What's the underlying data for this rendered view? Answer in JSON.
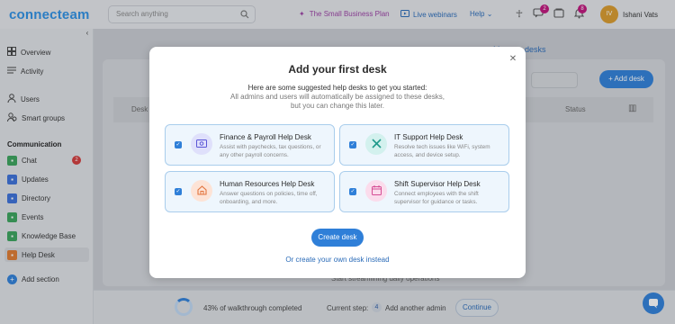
{
  "topbar": {
    "logo": "connecteam",
    "search_placeholder": "Search anything",
    "plan_label": "The Small Business Plan",
    "webinars_label": "Live webinars",
    "help_label": "Help",
    "chat_badge": "2",
    "notif_badge": "8",
    "user_initials": "IV",
    "user_name": "Ishani Vats"
  },
  "sidebar": {
    "items_top": [
      {
        "label": "Overview",
        "icon": "grid-icon"
      },
      {
        "label": "Activity",
        "icon": "list-icon"
      }
    ],
    "items_people": [
      {
        "label": "Users",
        "icon": "user-icon"
      },
      {
        "label": "Smart groups",
        "icon": "users-icon"
      }
    ],
    "section_title": "Communication",
    "items_comm": [
      {
        "label": "Chat",
        "icon": "chat-icon",
        "color": "#3aa35b",
        "badge": "2"
      },
      {
        "label": "Updates",
        "icon": "megaphone-icon",
        "color": "#3b6fd8"
      },
      {
        "label": "Directory",
        "icon": "book-icon",
        "color": "#3b6fd8"
      },
      {
        "label": "Events",
        "icon": "calendar-icon",
        "color": "#3aa35b"
      },
      {
        "label": "Knowledge Base",
        "icon": "folder-icon",
        "color": "#3aa35b"
      },
      {
        "label": "Help Desk",
        "icon": "helpdesk-icon",
        "color": "#e07a2f"
      }
    ],
    "add_section": "Add section"
  },
  "background": {
    "manage_desks": "Manage desks",
    "add_desk": "Add desk",
    "col_desk": "Desk n",
    "col_status": "Status",
    "footer_text": "Start streamlining daily operations"
  },
  "bottombar": {
    "progress_text": "43% of walkthrough completed",
    "progress": 0.43,
    "current_step_label": "Current step:",
    "step_number": "4",
    "step_text": "Add another admin",
    "continue_label": "Continue"
  },
  "modal": {
    "title": "Add your first desk",
    "subtitle": "Here are some suggested help desks to get you started:",
    "desc_line1": "All admins and users will automatically be assigned to these desks,",
    "desc_line2": "but you can change this later.",
    "options": [
      {
        "title": "Finance & Payroll Help Desk",
        "desc": "Assist with paychecks, tax questions, or any other payroll concerns.",
        "icon": "payroll-icon",
        "icon_bg": "#dfe0fb",
        "icon_color": "#5a55d6"
      },
      {
        "title": "IT Support Help Desk",
        "desc": "Resolve tech issues like WiFi, system access, and device setup.",
        "icon": "tools-icon",
        "icon_bg": "#d3f1ee",
        "icon_color": "#1f9a8c"
      },
      {
        "title": "Human Resources Help Desk",
        "desc": "Answer questions on policies, time off, onboarding, and more.",
        "icon": "home-icon",
        "icon_bg": "#fde3d6",
        "icon_color": "#e2743e"
      },
      {
        "title": "Shift Supervisor Help Desk",
        "desc": "Connect employees with the shift supervisor for guidance or tasks.",
        "icon": "calendar-icon",
        "icon_bg": "#fbdcec",
        "icon_color": "#d54d94"
      }
    ],
    "create_label": "Create desk",
    "own_label": "Or create your own desk instead"
  }
}
